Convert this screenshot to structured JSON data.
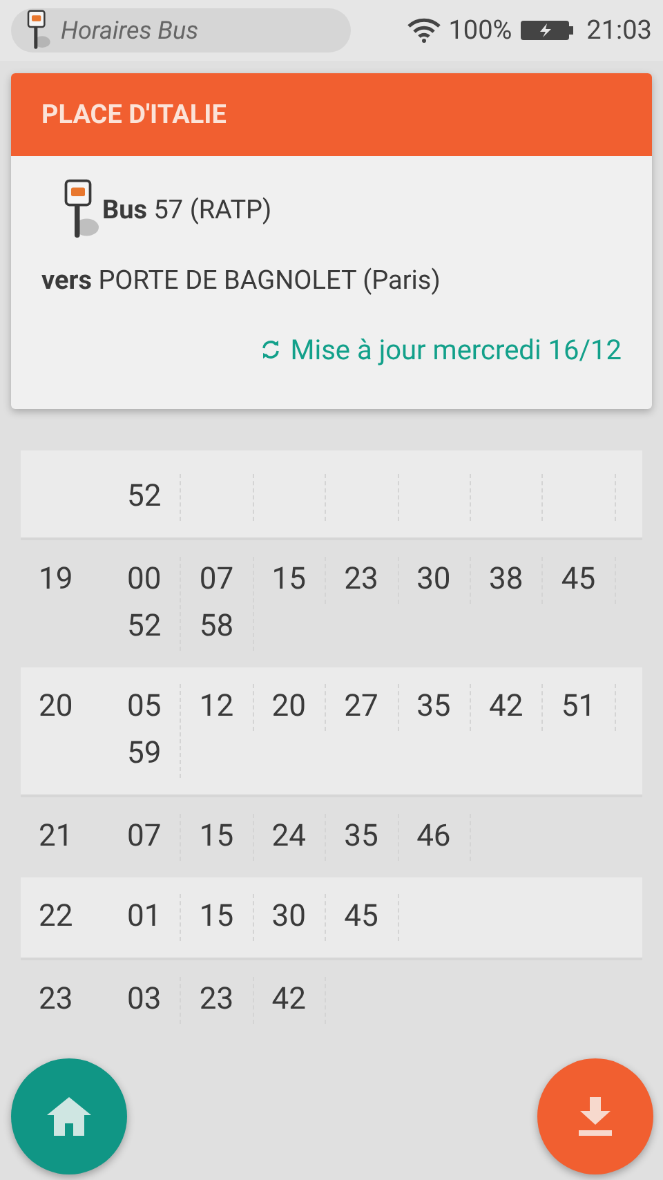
{
  "status_bar": {
    "app_title": "Horaires Bus",
    "battery": "100%",
    "time": "21:03"
  },
  "card": {
    "stop": "PLACE D'ITALIE",
    "line": "**Bus** 57 (RATP)",
    "direction": "**vers** PORTE DE BAGNOLET (Paris)",
    "update": "Mise à jour mercredi 16/12"
  },
  "timetable": [
    {
      "cut": true,
      "minutes": [
        [
          "52"
        ]
      ]
    },
    {
      "hour": "19",
      "minutes": [
        [
          "00",
          "52"
        ],
        [
          "07",
          "58"
        ],
        [
          "15"
        ],
        [
          "23"
        ],
        [
          "30"
        ],
        [
          "38"
        ],
        [
          "45"
        ]
      ]
    },
    {
      "hour": "20",
      "minutes": [
        [
          "05",
          "59"
        ],
        [
          "12"
        ],
        [
          "20"
        ],
        [
          "27"
        ],
        [
          "35"
        ],
        [
          "42"
        ],
        [
          "51"
        ]
      ]
    },
    {
      "hour": "21",
      "minutes": [
        [
          "07"
        ],
        [
          "15"
        ],
        [
          "24"
        ],
        [
          "35"
        ],
        [
          "46"
        ]
      ]
    },
    {
      "hour": "22",
      "minutes": [
        [
          "01"
        ],
        [
          "15"
        ],
        [
          "30"
        ],
        [
          "45"
        ]
      ]
    },
    {
      "hour": "23",
      "minutes": [
        [
          "03"
        ],
        [
          "23"
        ],
        [
          "42"
        ]
      ]
    }
  ]
}
